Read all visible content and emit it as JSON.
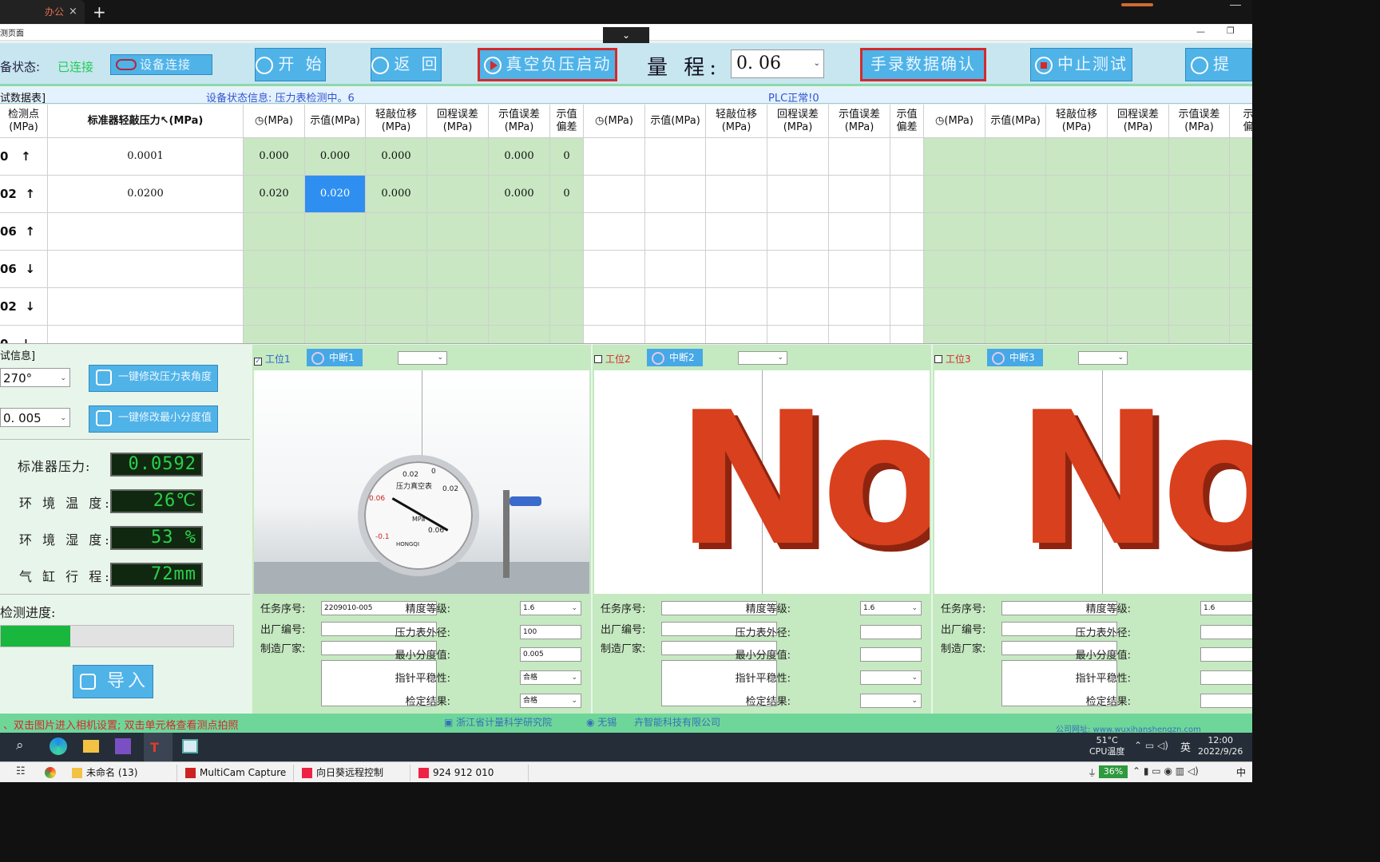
{
  "browser": {
    "tab_title": "办公",
    "tab_close": "×",
    "new_tab": "+",
    "window_title": "测页面",
    "collapse": "⌄"
  },
  "toolbar": {
    "device_state_label": "备状态:",
    "device_state_value": "已连接",
    "connect_btn": "设备连接",
    "start_btn": "开 始",
    "back_btn": "返 回",
    "vacuum_btn": "真空负压启动",
    "range_label": "量 程:",
    "range_value": "0. 06",
    "manual_confirm_btn": "手录数据确认",
    "abort_btn": "中止测试",
    "submit_btn": "提 交"
  },
  "status_line": {
    "table_title": "试数据表]",
    "device_info": "设备状态信息: 压力表检测中。6",
    "plc": "PLC正常!0"
  },
  "table": {
    "col_point": "检测点\n(MPa)",
    "col_std": "标准器轻敲压力↖(MPa)",
    "station_cols": [
      "◷(MPa)",
      "示值(MPa)",
      "轻敲位移\n(MPa)",
      "回程误差\n(MPa)",
      "示值误差\n(MPa)",
      "示值\n偏差"
    ],
    "rows": [
      {
        "point": "0   ↑",
        "std": "0.0001",
        "s1": [
          "0.000",
          "0.000",
          "0.000",
          "",
          "0.000",
          "0"
        ]
      },
      {
        "point": "02  ↑",
        "std": "0.0200",
        "s1": [
          "0.020",
          "0.020",
          "0.000",
          "",
          "0.000",
          "0"
        ]
      },
      {
        "point": "06  ↑",
        "std": "",
        "s1": [
          "",
          "",
          "",
          "",
          "",
          ""
        ]
      },
      {
        "point": "06  ↓",
        "std": "",
        "s1": [
          "",
          "",
          "",
          "",
          "",
          ""
        ]
      },
      {
        "point": "02  ↓",
        "std": "",
        "s1": [
          "",
          "",
          "",
          "",
          "",
          ""
        ]
      },
      {
        "point": "0   ↓",
        "std": "",
        "s1": [
          "",
          "",
          "",
          "",
          "",
          ""
        ]
      }
    ]
  },
  "left_panel": {
    "title": "试信息]",
    "angle_value": "270°",
    "angle_btn": "一键修改压力表角度",
    "division_value": "0. 005",
    "division_btn": "一键修改最小分度值",
    "std_pressure_label": "标准器压力:",
    "std_pressure_value": "0.0592",
    "temp_label": "环 境 温 度:",
    "temp_value": "26℃",
    "humidity_label": "环 境 湿 度:",
    "humidity_value": "53 %",
    "stroke_label": "气 缸 行 程:",
    "stroke_value": "72mm",
    "progress_label": "检测进度:",
    "progress": 0.3,
    "import_btn": "导入"
  },
  "stations": [
    {
      "check": "工位1",
      "checked": true,
      "interrupt": "中断1",
      "task_no": "2209010-005",
      "factory_no": "",
      "maker": "",
      "accuracy": "1.6",
      "diameter": "100",
      "min_div": "0.005",
      "stability": "合格",
      "result": "合格"
    },
    {
      "check": "工位2",
      "checked": false,
      "interrupt": "中断2",
      "task_no": "",
      "factory_no": "",
      "maker": "",
      "accuracy": "1.6",
      "diameter": "",
      "min_div": "",
      "stability": "",
      "result": ""
    },
    {
      "check": "工位3",
      "checked": false,
      "interrupt": "中断3",
      "task_no": "",
      "factory_no": "",
      "maker": "",
      "accuracy": "1.6",
      "diameter": "",
      "min_div": "",
      "stability": "",
      "result": ""
    }
  ],
  "form_labels": {
    "task_no": "任务序号:",
    "factory_no": "出厂编号:",
    "maker": "制造厂家:",
    "accuracy": "精度等级:",
    "diameter": "压力表外径:",
    "min_div": "最小分度值:",
    "stability": "指针平稳性:",
    "result": "检定结果:"
  },
  "image_text": {
    "no": "No",
    "gauge_title": "压力真空表",
    "gauge_unit": "MPa",
    "gauge_brand": "HONGQI",
    "ticks": [
      "-0.1",
      "0.06",
      "0.02",
      "0",
      "0.02",
      "0.06"
    ]
  },
  "bottom_status": {
    "hint": "双击图片进入相机设置; 双击单元格查看测点拍照",
    "org1": "浙江省计量科学研究院",
    "org2": "无锡",
    "org3": "智能科技有限公司",
    "website": "公司网址: www.wuxihanshengzn.com"
  },
  "taskbar": {
    "cpu_temp": "51°C",
    "cpu_label": "CPU温度",
    "ime": "英",
    "time": "12:00",
    "date": "2022/9/26",
    "tasks": [
      "未命名 (13)",
      "MultiCam Capture",
      "向日葵远程控制",
      "924 912 010"
    ],
    "battery": "36%",
    "ime2": "中"
  },
  "colors": {
    "accent": "#4fb3e8",
    "cell_green": "#c8e7c2",
    "alert_red": "#d42a2a",
    "lcd_green": "#2bd04a"
  }
}
